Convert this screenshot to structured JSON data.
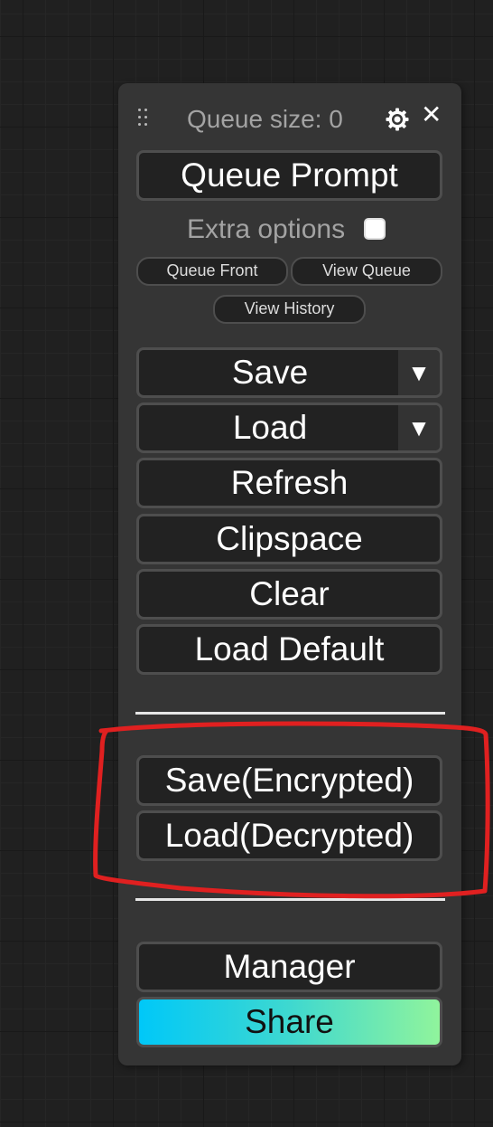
{
  "panel": {
    "queue_size_text": "Queue size: 0",
    "close_label": "✕",
    "queue_prompt_label": "Queue Prompt",
    "extra_options_label": "Extra options",
    "extra_options_checked": false,
    "queue_front_label": "Queue Front",
    "view_queue_label": "View Queue",
    "view_history_label": "View History",
    "save_label": "Save",
    "load_label": "Load",
    "dropdown_arrow": "▼",
    "refresh_label": "Refresh",
    "clipspace_label": "Clipspace",
    "clear_label": "Clear",
    "load_default_label": "Load Default",
    "save_encrypted_label": "Save(Encrypted)",
    "load_decrypted_label": "Load(Decrypted)",
    "manager_label": "Manager",
    "share_label": "Share"
  },
  "icons": {
    "drag": "drag-handle-icon",
    "settings": "gear-icon",
    "close": "close-icon",
    "dropdown": "chevron-down-icon"
  },
  "colors": {
    "canvas_bg": "#202020",
    "panel_bg": "#353535",
    "button_bg": "#222222",
    "button_border": "#4e4e4e",
    "annotation_stroke": "#e02020",
    "share_gradient_start": "#00c8f8",
    "share_gradient_end": "#90f49c"
  }
}
